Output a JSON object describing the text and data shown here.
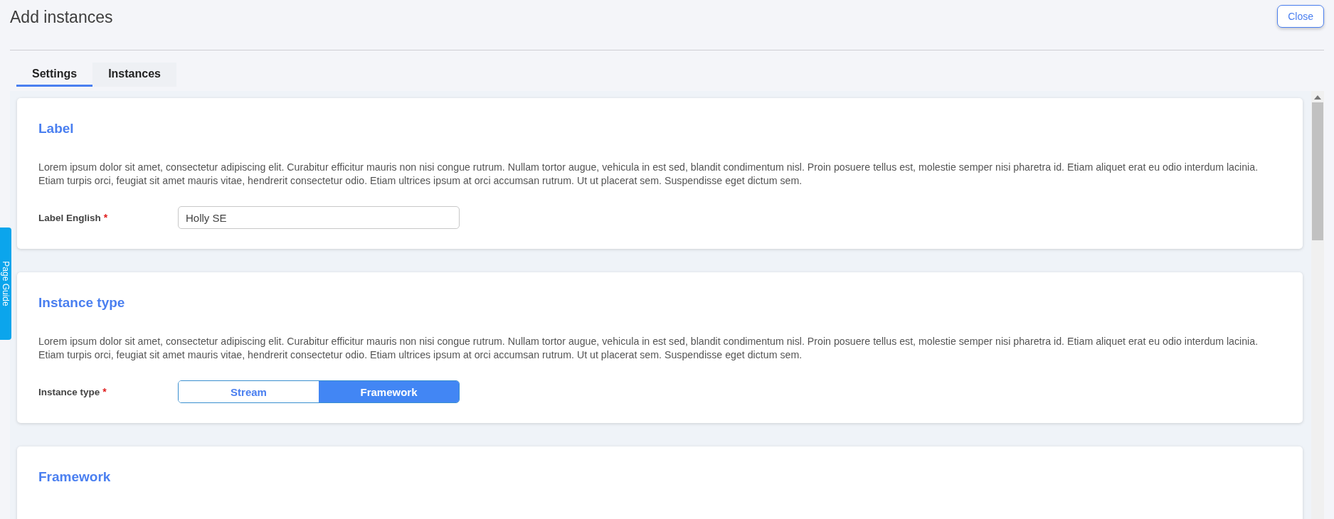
{
  "header": {
    "title": "Add instances",
    "close_button": "Close"
  },
  "tabs": [
    {
      "label": "Settings",
      "selected": true
    },
    {
      "label": "Instances",
      "selected": false
    }
  ],
  "side_tab": {
    "label": "Page Guide"
  },
  "sections": [
    {
      "title": "Label",
      "description": "Lorem ipsum dolor sit amet, consectetur adipiscing elit. Curabitur efficitur mauris non nisi congue rutrum. Nullam tortor augue, vehicula in est sed, blandit condimentum nisl. Proin posuere tellus est, molestie semper nisi pharetra id. Etiam aliquet erat eu odio interdum lacinia. Etiam turpis orci, feugiat sit amet mauris vitae, hendrerit consectetur odio. Etiam ultrices ipsum at orci accumsan rutrum. Ut ut placerat sem. Suspendisse eget dictum sem.",
      "field": {
        "kind": "text",
        "label": "Label English",
        "required_mark": "*",
        "value": "Holly SE"
      }
    },
    {
      "title": "Instance type",
      "description": "Lorem ipsum dolor sit amet, consectetur adipiscing elit. Curabitur efficitur mauris non nisi congue rutrum. Nullam tortor augue, vehicula in est sed, blandit condimentum nisl. Proin posuere tellus est, molestie semper nisi pharetra id. Etiam aliquet erat eu odio interdum lacinia. Etiam turpis orci, feugiat sit amet mauris vitae, hendrerit consectetur odio. Etiam ultrices ipsum at orci accumsan rutrum. Ut ut placerat sem. Suspendisse eget dictum sem.",
      "field": {
        "kind": "toggle",
        "label": "Instance type",
        "required_mark": "*",
        "options": [
          {
            "label": "Stream",
            "selected": false
          },
          {
            "label": "Framework",
            "selected": true
          }
        ]
      }
    },
    {
      "title": "Framework"
    }
  ]
}
